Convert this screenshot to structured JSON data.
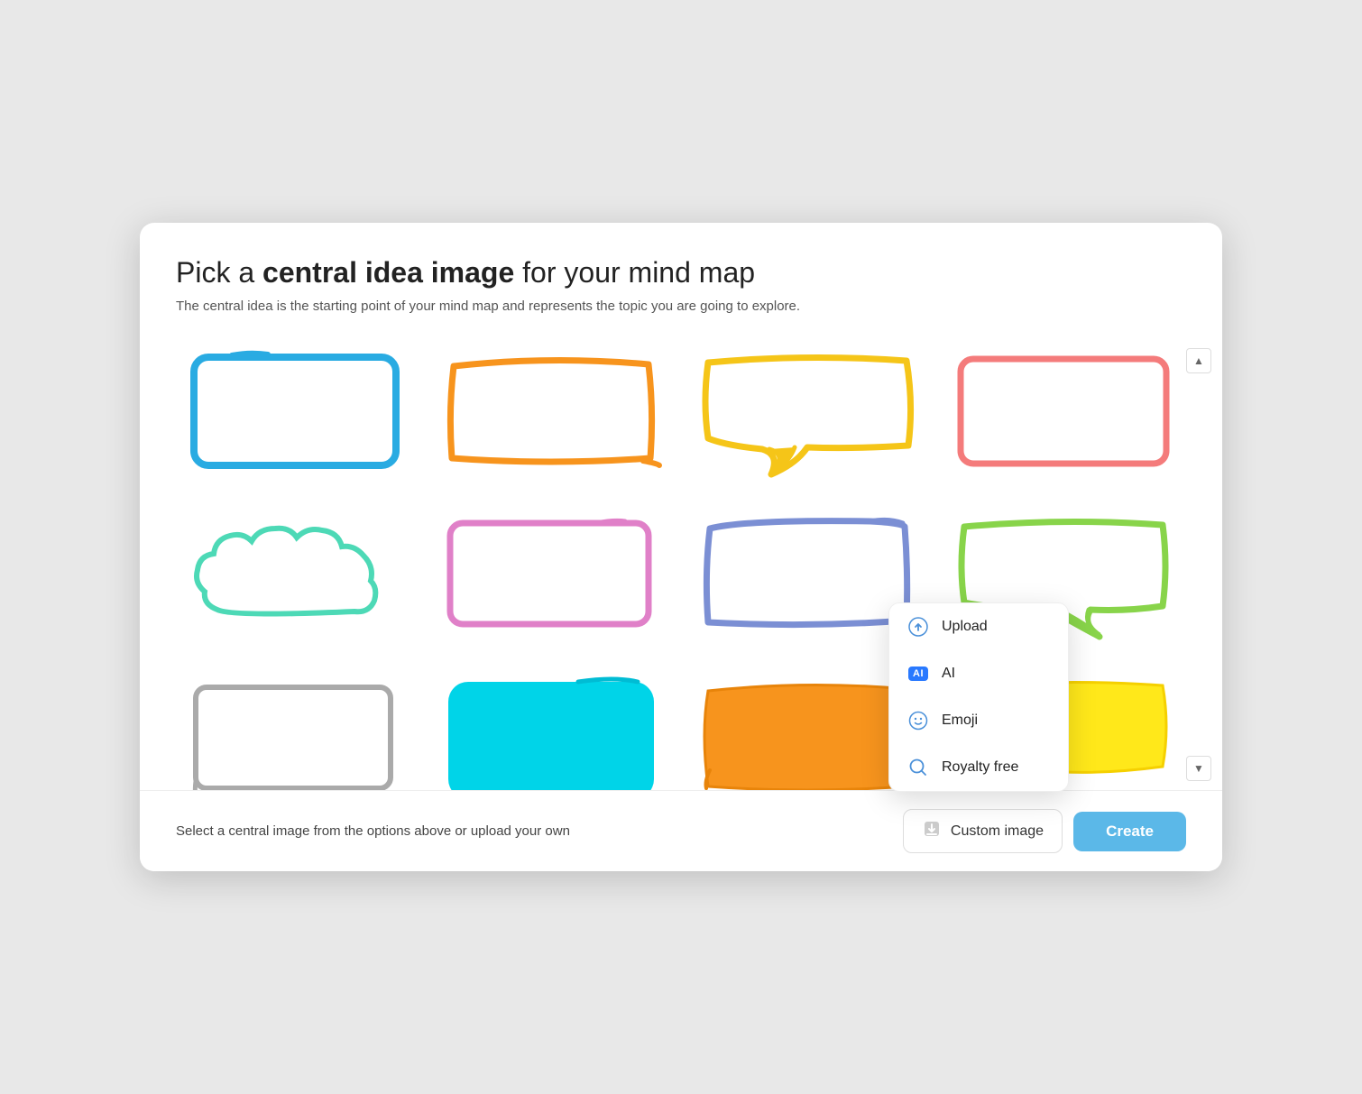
{
  "modal": {
    "title_prefix": "Pick a ",
    "title_bold": "central idea image",
    "title_suffix": " for your mind map",
    "subtitle": "The central idea is the starting point of your mind map and represents the topic you are going to explore.",
    "footer_hint": "Select a central image from the options above or upload your own",
    "custom_image_label": "Custom image",
    "create_label": "Create"
  },
  "dropdown": {
    "items": [
      {
        "id": "upload",
        "label": "Upload",
        "icon": "upload"
      },
      {
        "id": "ai",
        "label": "AI",
        "icon": "ai"
      },
      {
        "id": "emoji",
        "label": "Emoji",
        "icon": "emoji"
      },
      {
        "id": "royalty_free",
        "label": "Royalty free",
        "icon": "search"
      }
    ]
  },
  "scroll": {
    "up_label": "▲",
    "down_label": "▼"
  }
}
